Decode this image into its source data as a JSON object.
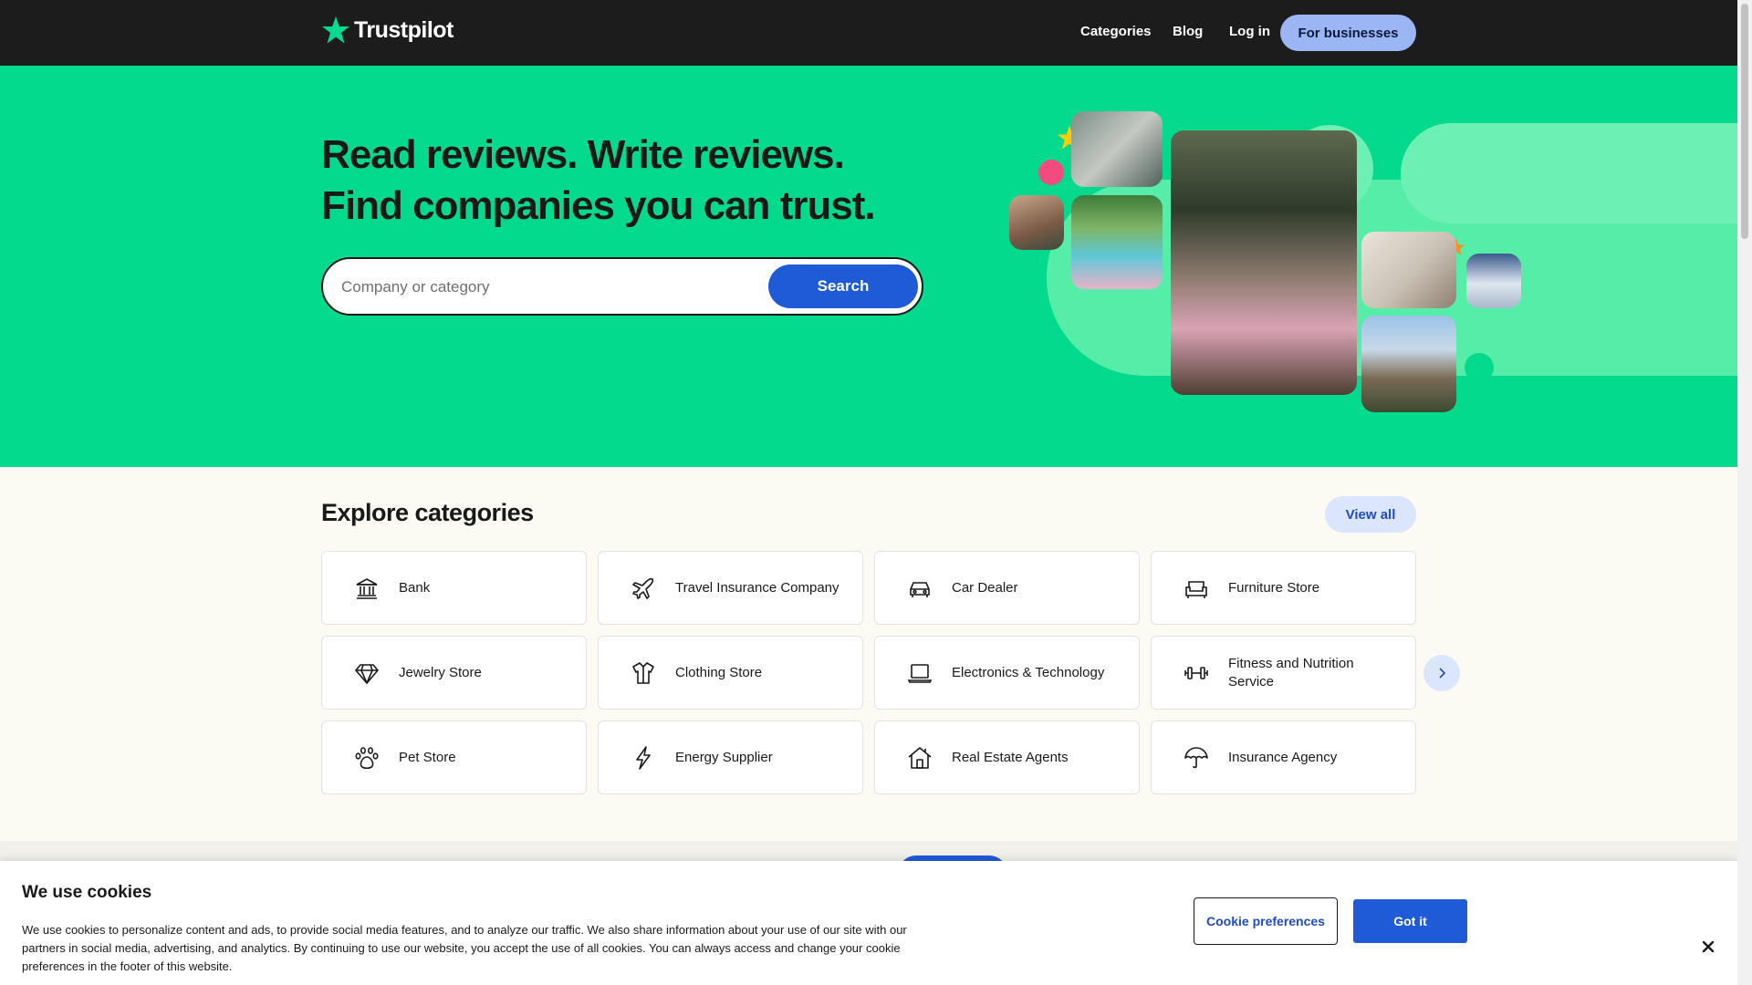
{
  "header": {
    "logo_text": "Trustpilot",
    "nav": [
      {
        "label": "Categories"
      },
      {
        "label": "Blog"
      },
      {
        "label": "Log in"
      }
    ],
    "business_button": "For businesses"
  },
  "hero": {
    "title_line1": "Read reviews. Write reviews.",
    "title_line2": "Find companies you can trust.",
    "search_placeholder": "Company or category",
    "search_button": "Search"
  },
  "categories": {
    "title": "Explore categories",
    "view_all": "View all",
    "items": [
      {
        "label": "Bank",
        "icon": "bank-icon"
      },
      {
        "label": "Travel Insurance Company",
        "icon": "airplane-icon"
      },
      {
        "label": "Car Dealer",
        "icon": "car-icon"
      },
      {
        "label": "Furniture Store",
        "icon": "sofa-icon"
      },
      {
        "label": "Jewelry Store",
        "icon": "diamond-icon"
      },
      {
        "label": "Clothing Store",
        "icon": "shirt-icon"
      },
      {
        "label": "Electronics & Technology",
        "icon": "laptop-icon"
      },
      {
        "label": "Fitness and Nutrition Service",
        "icon": "dumbbell-icon"
      },
      {
        "label": "Pet Store",
        "icon": "paw-icon"
      },
      {
        "label": "Energy Supplier",
        "icon": "lightning-icon"
      },
      {
        "label": "Real Estate Agents",
        "icon": "house-icon"
      },
      {
        "label": "Insurance Agency",
        "icon": "umbrella-icon"
      }
    ]
  },
  "cookie": {
    "title": "We use cookies",
    "text": "We use cookies to personalize content and ads, to provide social media features, and to analyze our traffic. We also share information about your use of our site with our partners in social media, advertising, and analytics. By continuing to use our website, you accept the use of all cookies. You can always access and change your cookie preferences in the footer of this website.",
    "preferences_button": "Cookie preferences",
    "accept_button": "Got it"
  },
  "colors": {
    "brand_green": "#04da8d",
    "header_bg": "#1c1c1c",
    "primary_blue": "#1f5bd7",
    "light_blue": "#9bb5f5"
  }
}
